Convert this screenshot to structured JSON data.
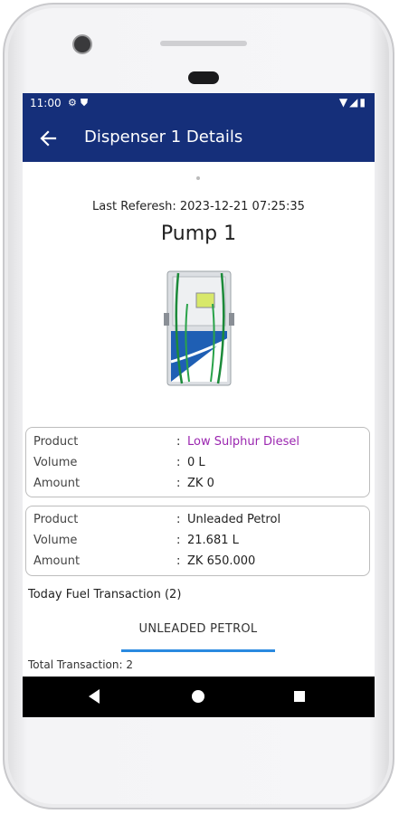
{
  "status": {
    "time": "11:00"
  },
  "appbar": {
    "title": "Dispenser 1 Details"
  },
  "refresh": {
    "text": "Last Referesh: 2023-12-21 07:25:35"
  },
  "pump": {
    "title": "Pump 1"
  },
  "cards": [
    {
      "rows": [
        {
          "label": "Product",
          "value": "Low Sulphur Diesel"
        },
        {
          "label": "Volume",
          "value": "0 L"
        },
        {
          "label": "Amount",
          "value": "ZK 0"
        }
      ]
    },
    {
      "rows": [
        {
          "label": "Product",
          "value": "Unleaded Petrol"
        },
        {
          "label": "Volume",
          "value": "21.681 L"
        },
        {
          "label": "Amount",
          "value": "ZK 650.000"
        }
      ]
    }
  ],
  "colon": ":",
  "transactions": {
    "title": "Today Fuel Transaction (2)",
    "tab_label": "UNLEADED PETROL",
    "total_label": "Total Transaction:",
    "total_value": "2"
  },
  "colors": {
    "appbar": "#152f7a",
    "highlight_value": "#9b27b0",
    "tab_indicator": "#2a8ae0"
  },
  "icons": {
    "back": "arrow-left-icon",
    "settings": "gear-icon",
    "shield": "shield-icon",
    "wifi": "wifi-icon",
    "signal": "signal-icon",
    "battery": "battery-icon"
  }
}
